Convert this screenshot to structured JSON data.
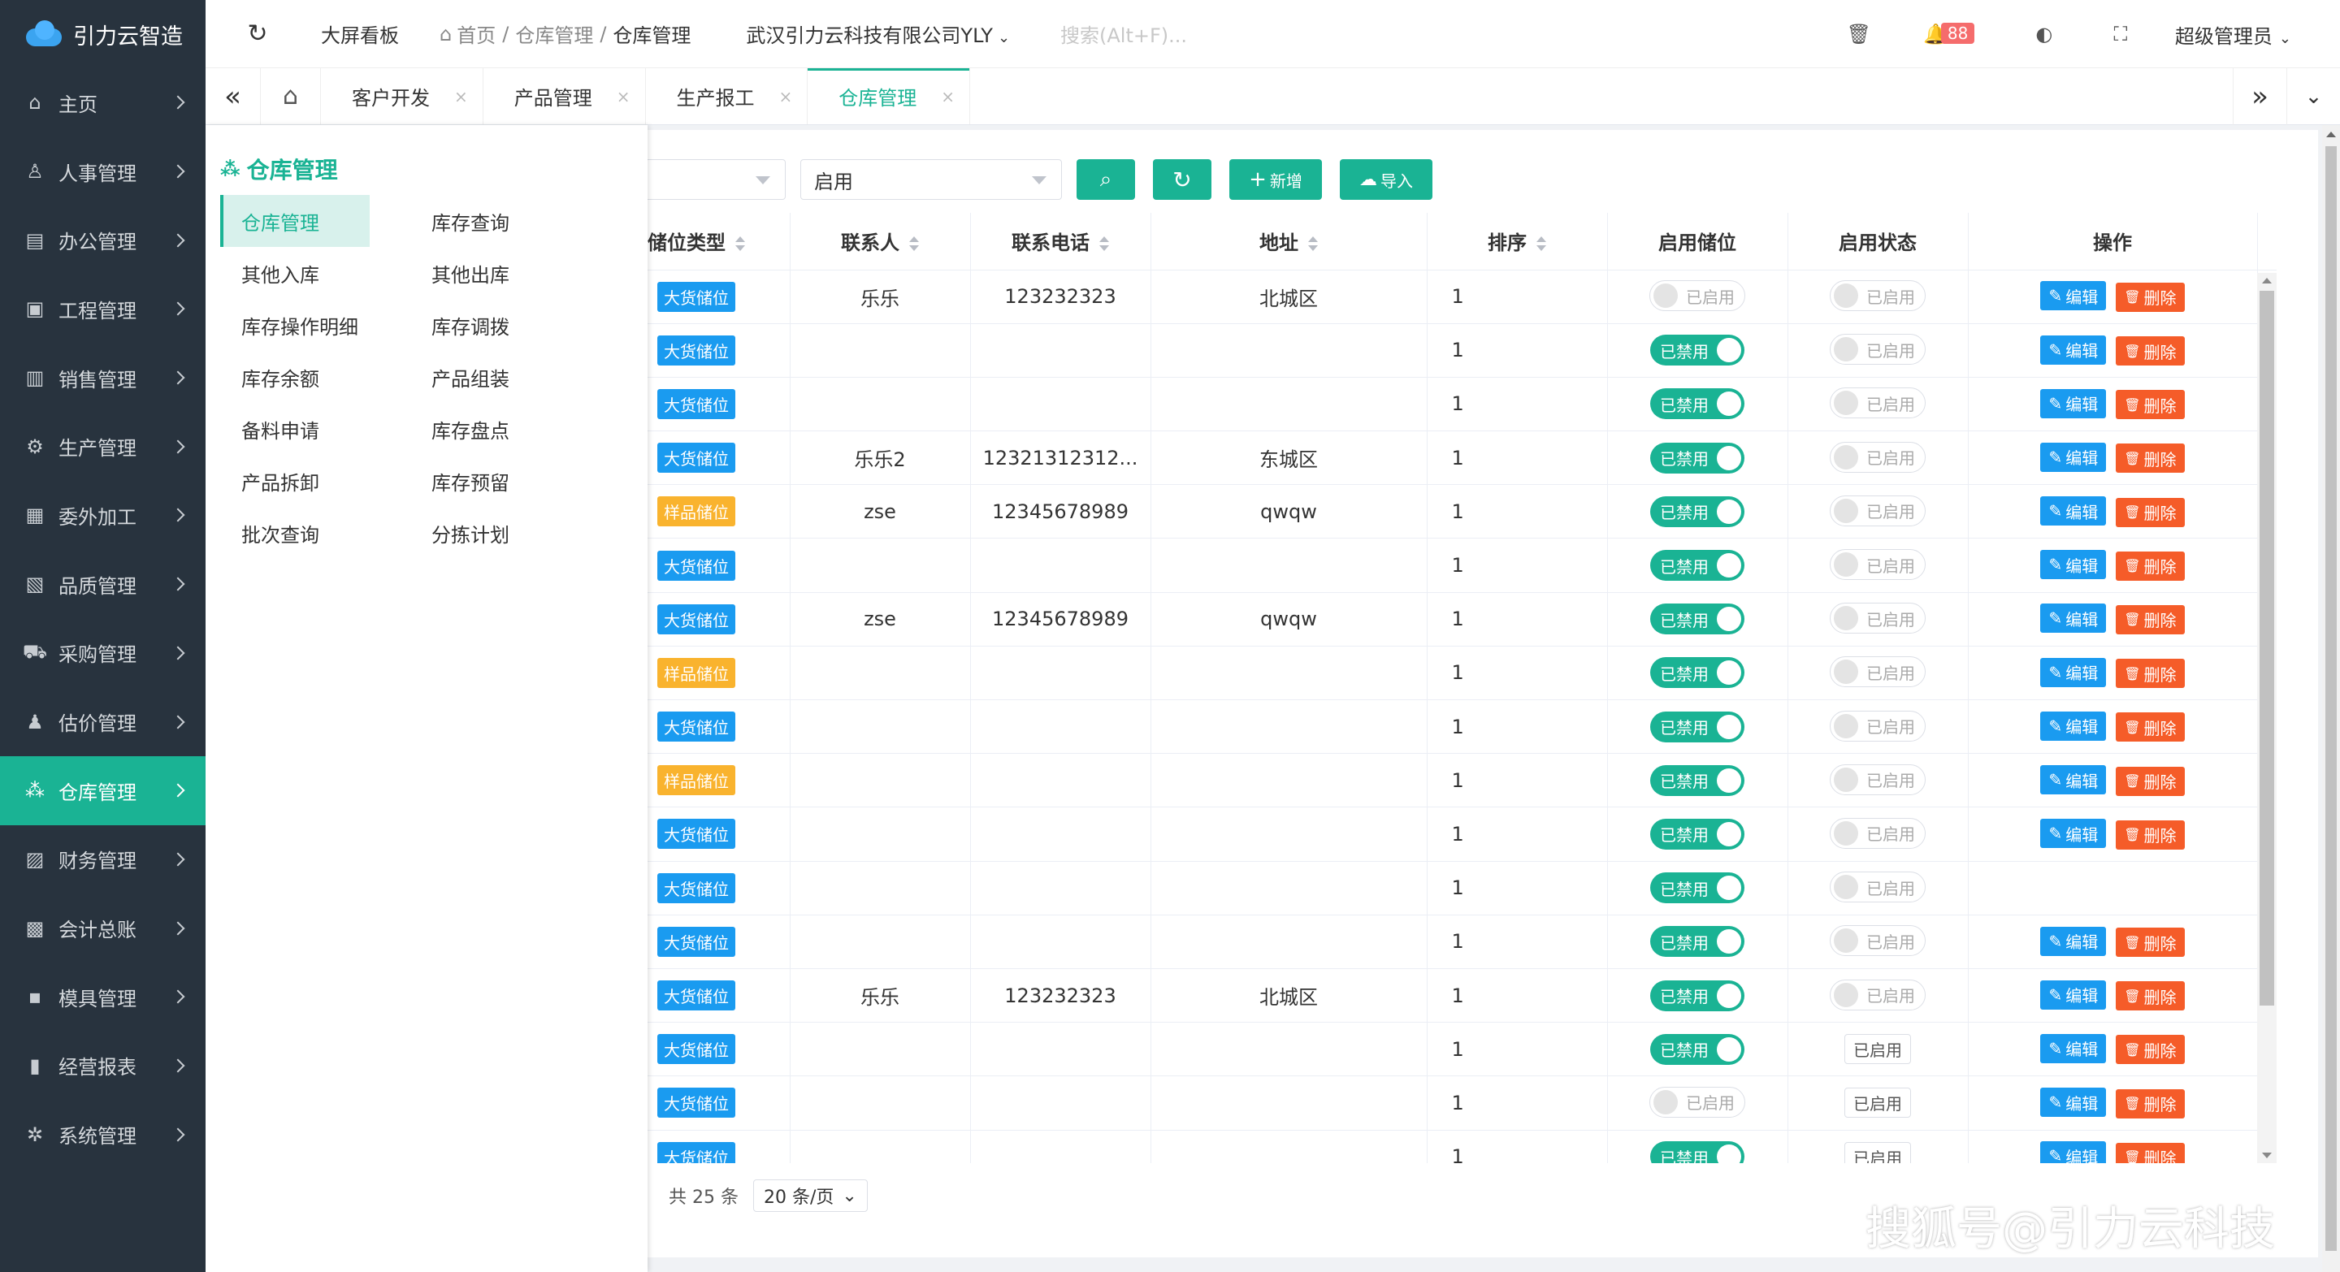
{
  "logo": {
    "name": "引力云智造"
  },
  "sidebar": {
    "items": [
      {
        "label": "主页",
        "icon": "home-icon",
        "glyph": "⌂"
      },
      {
        "label": "人事管理",
        "icon": "person-icon",
        "glyph": "♙"
      },
      {
        "label": "办公管理",
        "icon": "office-icon",
        "glyph": "▤"
      },
      {
        "label": "工程管理",
        "icon": "monitor-icon",
        "glyph": "▣"
      },
      {
        "label": "销售管理",
        "icon": "sales-icon",
        "glyph": "▥"
      },
      {
        "label": "生产管理",
        "icon": "gears-icon",
        "glyph": "⚙"
      },
      {
        "label": "委外加工",
        "icon": "outsource-icon",
        "glyph": "▦"
      },
      {
        "label": "品质管理",
        "icon": "quality-icon",
        "glyph": "▧"
      },
      {
        "label": "采购管理",
        "icon": "cart-icon",
        "glyph": "⛟"
      },
      {
        "label": "估价管理",
        "icon": "users-icon",
        "glyph": "♟"
      },
      {
        "label": "仓库管理",
        "icon": "warehouse-icon",
        "glyph": "⁂"
      },
      {
        "label": "财务管理",
        "icon": "finance-icon",
        "glyph": "▨"
      },
      {
        "label": "会计总账",
        "icon": "ledger-icon",
        "glyph": "▩"
      },
      {
        "label": "模具管理",
        "icon": "mold-icon",
        "glyph": "▪"
      },
      {
        "label": "经营报表",
        "icon": "chart-icon",
        "glyph": "▮"
      },
      {
        "label": "系统管理",
        "icon": "settings-icon",
        "glyph": "✲"
      }
    ],
    "active_index": 10
  },
  "topbar": {
    "bigscreen": "大屏看板",
    "breadcrumb_home": "首页",
    "breadcrumb_sep": "/",
    "breadcrumb_1": "仓库管理",
    "breadcrumb_2": "仓库管理",
    "company": "武汉引力云科技有限公司YLY",
    "search_placeholder": "搜索(Alt+F)...",
    "notification_count": "88",
    "user": "超级管理员"
  },
  "tabs": [
    {
      "label": "客户开发"
    },
    {
      "label": "产品管理"
    },
    {
      "label": "生产报工"
    },
    {
      "label": "仓库管理"
    }
  ],
  "dropdown": {
    "title": "仓库管理",
    "items": [
      "仓库管理",
      "库存查询",
      "其他入库",
      "其他出库",
      "库存操作明细",
      "库存调拨",
      "库存余额",
      "产品组装",
      "备料申请",
      "库存盘点",
      "产品拆卸",
      "库存预留",
      "批次查询",
      "分拣计划"
    ]
  },
  "filters": {
    "status_value": "启用",
    "add_label": "新增",
    "import_label": "导入"
  },
  "table": {
    "headers": [
      "储位类型",
      "联系人",
      "联系电话",
      "地址",
      "排序",
      "启用储位",
      "启用状态",
      "操作"
    ],
    "enabled_on": "已禁用",
    "enabled_off": "已启用",
    "status_label": "已启用",
    "edit_label": "编辑",
    "delete_label": "删除",
    "rows": [
      {
        "type": "大货储位",
        "color": "blue",
        "contact": "乐乐",
        "phone": "123232323",
        "address": "北城区",
        "sort": "1",
        "loc": "off",
        "status": "switch",
        "ops": true
      },
      {
        "type": "大货储位",
        "color": "blue",
        "contact": "",
        "phone": "",
        "address": "",
        "sort": "1",
        "loc": "on",
        "status": "switch",
        "ops": true
      },
      {
        "type": "大货储位",
        "color": "blue",
        "contact": "",
        "phone": "",
        "address": "",
        "sort": "1",
        "loc": "on",
        "status": "switch",
        "ops": true
      },
      {
        "type": "大货储位",
        "color": "blue",
        "contact": "乐乐2",
        "phone": "12321312312...",
        "address": "东城区",
        "sort": "1",
        "loc": "on",
        "status": "switch",
        "ops": true
      },
      {
        "type": "样品储位",
        "color": "orange",
        "contact": "zse",
        "phone": "12345678989",
        "address": "qwqw",
        "sort": "1",
        "loc": "on",
        "status": "switch",
        "ops": true
      },
      {
        "type": "大货储位",
        "color": "blue",
        "contact": "",
        "phone": "",
        "address": "",
        "sort": "1",
        "loc": "on",
        "status": "switch",
        "ops": true
      },
      {
        "type": "大货储位",
        "color": "blue",
        "contact": "zse",
        "phone": "12345678989",
        "address": "qwqw",
        "sort": "1",
        "loc": "on",
        "status": "switch",
        "ops": true
      },
      {
        "type": "样品储位",
        "color": "orange",
        "contact": "",
        "phone": "",
        "address": "",
        "sort": "1",
        "loc": "on",
        "status": "switch",
        "ops": true
      },
      {
        "type": "大货储位",
        "color": "blue",
        "contact": "",
        "phone": "",
        "address": "",
        "sort": "1",
        "loc": "on",
        "status": "switch",
        "ops": true
      },
      {
        "type": "样品储位",
        "color": "orange",
        "contact": "",
        "phone": "",
        "address": "",
        "sort": "1",
        "loc": "on",
        "status": "switch",
        "ops": true
      },
      {
        "type": "大货储位",
        "color": "blue",
        "contact": "",
        "phone": "",
        "address": "",
        "sort": "1",
        "loc": "on",
        "status": "switch",
        "ops": true
      },
      {
        "type": "大货储位",
        "color": "blue",
        "contact": "",
        "phone": "",
        "address": "",
        "sort": "1",
        "loc": "on",
        "status": "switch",
        "ops": false
      },
      {
        "type": "大货储位",
        "color": "blue",
        "contact": "",
        "phone": "",
        "address": "",
        "sort": "1",
        "loc": "on",
        "status": "switch",
        "ops": true
      },
      {
        "type": "大货储位",
        "color": "blue",
        "contact": "乐乐",
        "phone": "123232323",
        "address": "北城区",
        "sort": "1",
        "loc": "on",
        "status": "switch",
        "ops": true
      },
      {
        "type": "大货储位",
        "color": "blue",
        "contact": "",
        "phone": "",
        "address": "",
        "sort": "1",
        "loc": "on",
        "status": "plain",
        "ops": true
      },
      {
        "type": "大货储位",
        "color": "blue",
        "contact": "",
        "phone": "",
        "address": "",
        "sort": "1",
        "loc": "off",
        "status": "plain",
        "ops": true
      },
      {
        "type": "大货储位",
        "color": "blue",
        "contact": "",
        "phone": "",
        "address": "",
        "sort": "1",
        "loc": "on",
        "status": "plain",
        "ops": true
      }
    ]
  },
  "pager": {
    "total": "共 25 条",
    "size": "20 条/页"
  },
  "watermark": "搜狐号@引力云科技"
}
